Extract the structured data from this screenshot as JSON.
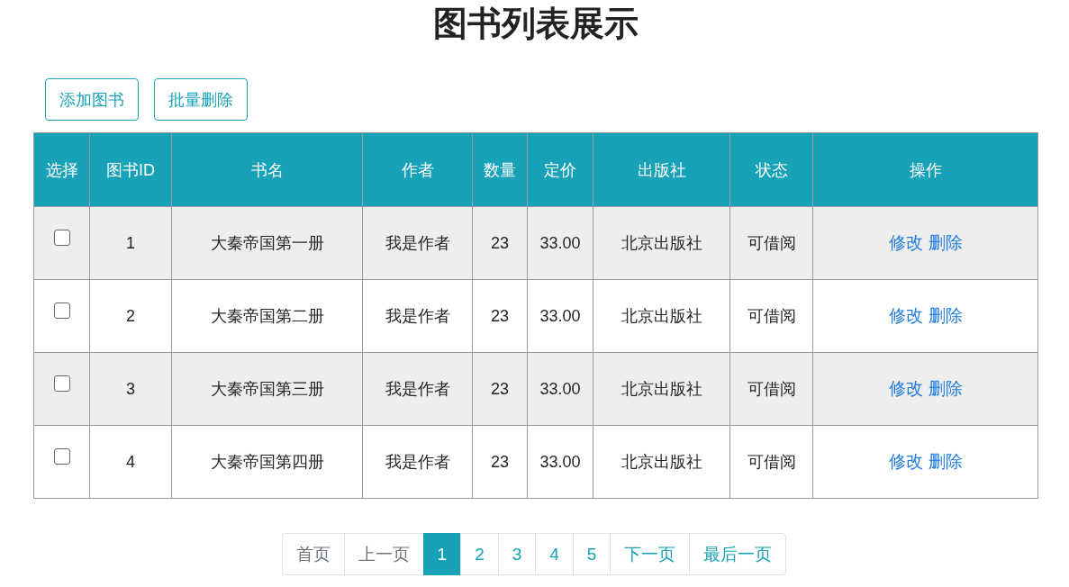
{
  "title": "图书列表展示",
  "toolbar": [
    {
      "label": "添加图书"
    },
    {
      "label": "批量删除"
    }
  ],
  "table": {
    "columns": [
      "选择",
      "图书ID",
      "书名",
      "作者",
      "数量",
      "定价",
      "出版社",
      "状态",
      "操作"
    ],
    "rows": [
      {
        "checked": false,
        "id": "1",
        "name": "大秦帝国第一册",
        "author": "我是作者",
        "count": "23",
        "price": "33.00",
        "publisher": "北京出版社",
        "status": "可借阅",
        "actions": [
          "修改",
          "删除"
        ]
      },
      {
        "checked": false,
        "id": "2",
        "name": "大秦帝国第二册",
        "author": "我是作者",
        "count": "23",
        "price": "33.00",
        "publisher": "北京出版社",
        "status": "可借阅",
        "actions": [
          "修改",
          "删除"
        ]
      },
      {
        "checked": false,
        "id": "3",
        "name": "大秦帝国第三册",
        "author": "我是作者",
        "count": "23",
        "price": "33.00",
        "publisher": "北京出版社",
        "status": "可借阅",
        "actions": [
          "修改",
          "删除"
        ]
      },
      {
        "checked": false,
        "id": "4",
        "name": "大秦帝国第四册",
        "author": "我是作者",
        "count": "23",
        "price": "33.00",
        "publisher": "北京出版社",
        "status": "可借阅",
        "actions": [
          "修改",
          "删除"
        ]
      }
    ]
  },
  "pagination": [
    {
      "label": "首页",
      "disabled": true,
      "selected": false
    },
    {
      "label": "上一页",
      "disabled": true,
      "selected": false
    },
    {
      "label": "1",
      "disabled": false,
      "selected": true
    },
    {
      "label": "2",
      "disabled": false,
      "selected": false
    },
    {
      "label": "3",
      "disabled": false,
      "selected": false
    },
    {
      "label": "4",
      "disabled": false,
      "selected": false
    },
    {
      "label": "5",
      "disabled": false,
      "selected": false
    },
    {
      "label": "下一页",
      "disabled": false,
      "selected": false
    },
    {
      "label": "最后一页",
      "disabled": false,
      "selected": false
    }
  ]
}
